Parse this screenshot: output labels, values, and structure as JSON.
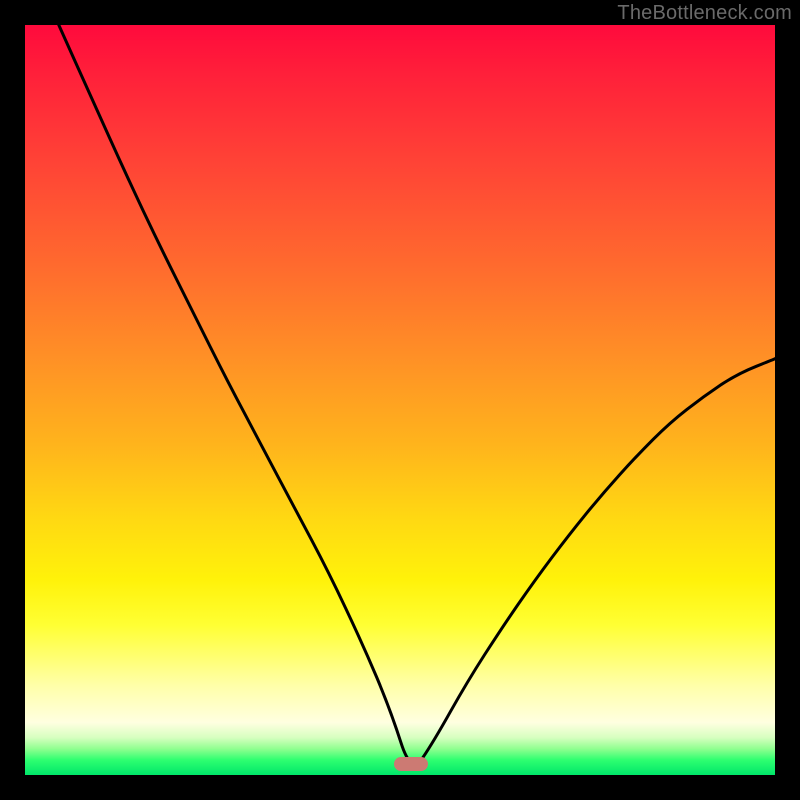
{
  "watermark": "TheBottleneck.com",
  "marker": {
    "x_frac": 0.515,
    "y_frac": 0.985
  },
  "chart_data": {
    "type": "line",
    "title": "",
    "xlabel": "",
    "ylabel": "",
    "xlim": [
      0,
      1
    ],
    "ylim": [
      0,
      1
    ],
    "note": "Axes are unlabelled in the source image; values are normalized fractions of the plot area. The single black curve descends steeply from top-left to a minimum near x≈0.52 (bottleneck), then rises more gently toward the right edge reaching y≈0.56.",
    "series": [
      {
        "name": "bottleneck-curve",
        "x": [
          0.045,
          0.09,
          0.135,
          0.18,
          0.225,
          0.27,
          0.315,
          0.36,
          0.405,
          0.45,
          0.488,
          0.515,
          0.545,
          0.59,
          0.635,
          0.68,
          0.725,
          0.77,
          0.815,
          0.86,
          0.905,
          0.95,
          1.0
        ],
        "y": [
          1.0,
          0.9,
          0.8,
          0.705,
          0.615,
          0.525,
          0.44,
          0.355,
          0.27,
          0.175,
          0.085,
          0.0,
          0.045,
          0.125,
          0.195,
          0.26,
          0.32,
          0.375,
          0.425,
          0.47,
          0.505,
          0.535,
          0.555
        ]
      }
    ],
    "marker": {
      "x": 0.515,
      "y": 0.015,
      "color": "#cc7a73",
      "shape": "rounded-rect"
    },
    "background_gradient": {
      "direction": "vertical",
      "stops": [
        {
          "pos": 0.0,
          "color": "#ff0a3c"
        },
        {
          "pos": 0.32,
          "color": "#ff6a2e"
        },
        {
          "pos": 0.66,
          "color": "#ffd912"
        },
        {
          "pos": 0.88,
          "color": "#ffffa8"
        },
        {
          "pos": 0.96,
          "color": "#90ff90"
        },
        {
          "pos": 1.0,
          "color": "#00e66a"
        }
      ]
    }
  }
}
